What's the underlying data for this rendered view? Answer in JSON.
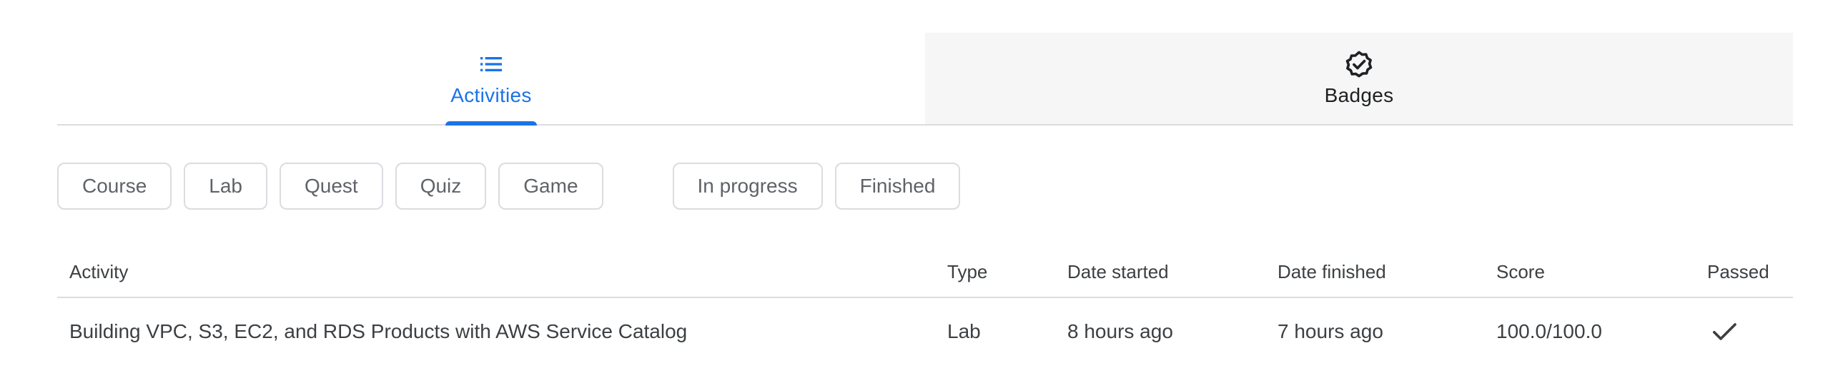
{
  "tabs": [
    {
      "label": "Activities",
      "icon": "list-icon",
      "active": true
    },
    {
      "label": "Badges",
      "icon": "badge-check-icon",
      "active": false
    }
  ],
  "filters": {
    "type_chips": [
      "Course",
      "Lab",
      "Quest",
      "Quiz",
      "Game"
    ],
    "status_chips": [
      "In progress",
      "Finished"
    ]
  },
  "table": {
    "headers": {
      "activity": "Activity",
      "type": "Type",
      "date_started": "Date started",
      "date_finished": "Date finished",
      "score": "Score",
      "passed": "Passed"
    },
    "rows": [
      {
        "activity": "Building VPC, S3, EC2, and RDS Products with AWS Service Catalog",
        "type": "Lab",
        "date_started": "8 hours ago",
        "date_finished": "7 hours ago",
        "score": "100.0/100.0",
        "passed_icon": "checkmark-icon"
      }
    ]
  },
  "colors": {
    "accent": "#1a73e8",
    "border": "#dadce0",
    "inactive_tab_bg": "#f5f6f5",
    "text": "#3c4043"
  }
}
